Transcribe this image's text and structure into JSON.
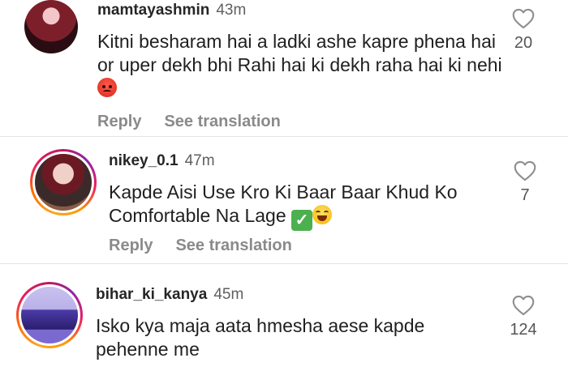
{
  "comments": [
    {
      "username": "mamtayashmin",
      "time": "43m",
      "text": "Kitni besharam hai a ladki ashe kapre phena hai or uper dekh bhi Rahi hai ki dekh raha hai ki nehi",
      "emoji": "angry-face",
      "likes": "20",
      "reply_label": "Reply",
      "translate_label": "See translation"
    },
    {
      "username": "nikey_0.1",
      "time": "47m",
      "text": "Kapde Aisi Use Kro Ki Baar Baar Khud Ko Comfortable Na Lage ",
      "emoji": "check-mark, laughing-face",
      "likes": "7",
      "reply_label": "Reply",
      "translate_label": "See translation"
    },
    {
      "username": "bihar_ki_kanya",
      "time": "45m",
      "text": "Isko kya maja aata hmesha aese kapde pehenne me",
      "likes": "124"
    }
  ],
  "colors": {
    "story_ring": "#e91e63",
    "action_text": "#8a8a8a",
    "divider": "#e3e3e3"
  }
}
